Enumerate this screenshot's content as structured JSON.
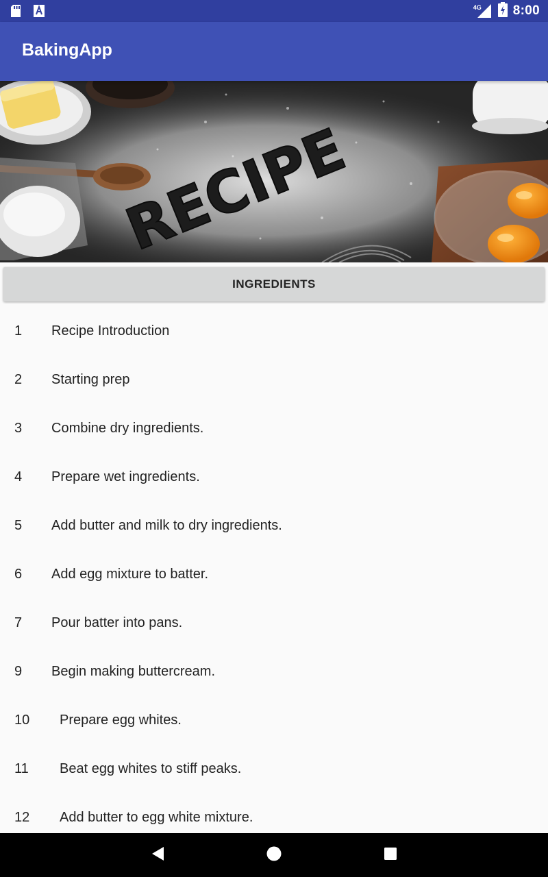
{
  "status_bar": {
    "network": "4G",
    "time": "8:00",
    "icons": [
      "sd-card-icon",
      "notification-a-icon",
      "signal-icon",
      "battery-charging-icon"
    ]
  },
  "app_bar": {
    "title": "BakingApp"
  },
  "hero": {
    "flour_text": "RECIPE"
  },
  "ingredients_button": {
    "label": "INGREDIENTS"
  },
  "steps": [
    {
      "number": "1",
      "label": "Recipe Introduction"
    },
    {
      "number": "2",
      "label": "Starting prep"
    },
    {
      "number": "3",
      "label": "Combine dry ingredients."
    },
    {
      "number": "4",
      "label": "Prepare wet ingredients."
    },
    {
      "number": "5",
      "label": "Add butter and milk to dry ingredients."
    },
    {
      "number": "6",
      "label": "Add egg mixture to batter."
    },
    {
      "number": "7",
      "label": "Pour batter into pans."
    },
    {
      "number": "9",
      "label": "Begin making buttercream."
    },
    {
      "number": "10",
      "label": "Prepare egg whites."
    },
    {
      "number": "11",
      "label": "Beat egg whites to stiff peaks."
    },
    {
      "number": "12",
      "label": "Add butter to egg white mixture."
    }
  ],
  "nav_bar": {
    "icons": [
      "back-icon",
      "home-icon",
      "recents-icon"
    ]
  },
  "colors": {
    "status_bar": "#303f9f",
    "app_bar": "#3f51b5",
    "button": "#d6d7d7",
    "background": "#fafafa"
  }
}
